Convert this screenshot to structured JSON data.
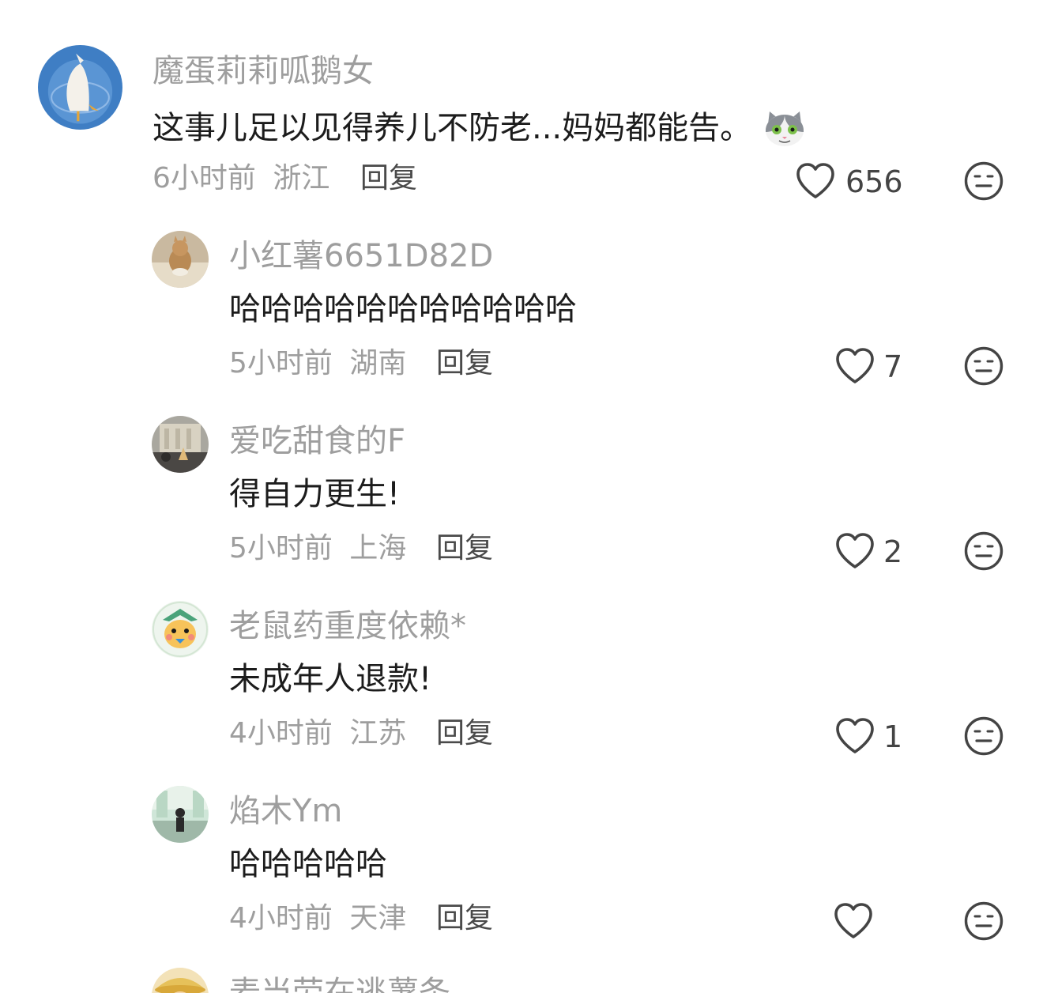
{
  "comments": [
    {
      "username": "魔蛋莉莉呱鹅女",
      "content": "这事儿足以见得养儿不防老...妈妈都能告。",
      "time": "6小时前",
      "location": "浙江",
      "reply_label": "回复",
      "likes": "656",
      "emoji": "cat-emoji"
    },
    {
      "username": "小红薯6651D82D",
      "content": "哈哈哈哈哈哈哈哈哈哈哈",
      "time": "5小时前",
      "location": "湖南",
      "reply_label": "回复",
      "likes": "7"
    },
    {
      "username": "爱吃甜食的F",
      "content": "得自力更生!",
      "time": "5小时前",
      "location": "上海",
      "reply_label": "回复",
      "likes": "2"
    },
    {
      "username": "老鼠药重度依赖*",
      "content": "未成年人退款!",
      "time": "4小时前",
      "location": "江苏",
      "reply_label": "回复",
      "likes": "1"
    },
    {
      "username": "焰木Ym",
      "content": "哈哈哈哈哈",
      "time": "4小时前",
      "location": "天津",
      "reply_label": "回复",
      "likes": ""
    },
    {
      "username": "麦当劳在逃薯条",
      "partial": true
    }
  ],
  "icons": {
    "like": "heart-outline-icon",
    "dislike": "neutral-face-icon"
  },
  "colors": {
    "username": "#9e9e9e",
    "content": "#1c1c1c",
    "meta": "#9e9e9e",
    "reply": "#4a4a4a",
    "icon": "#444444"
  }
}
